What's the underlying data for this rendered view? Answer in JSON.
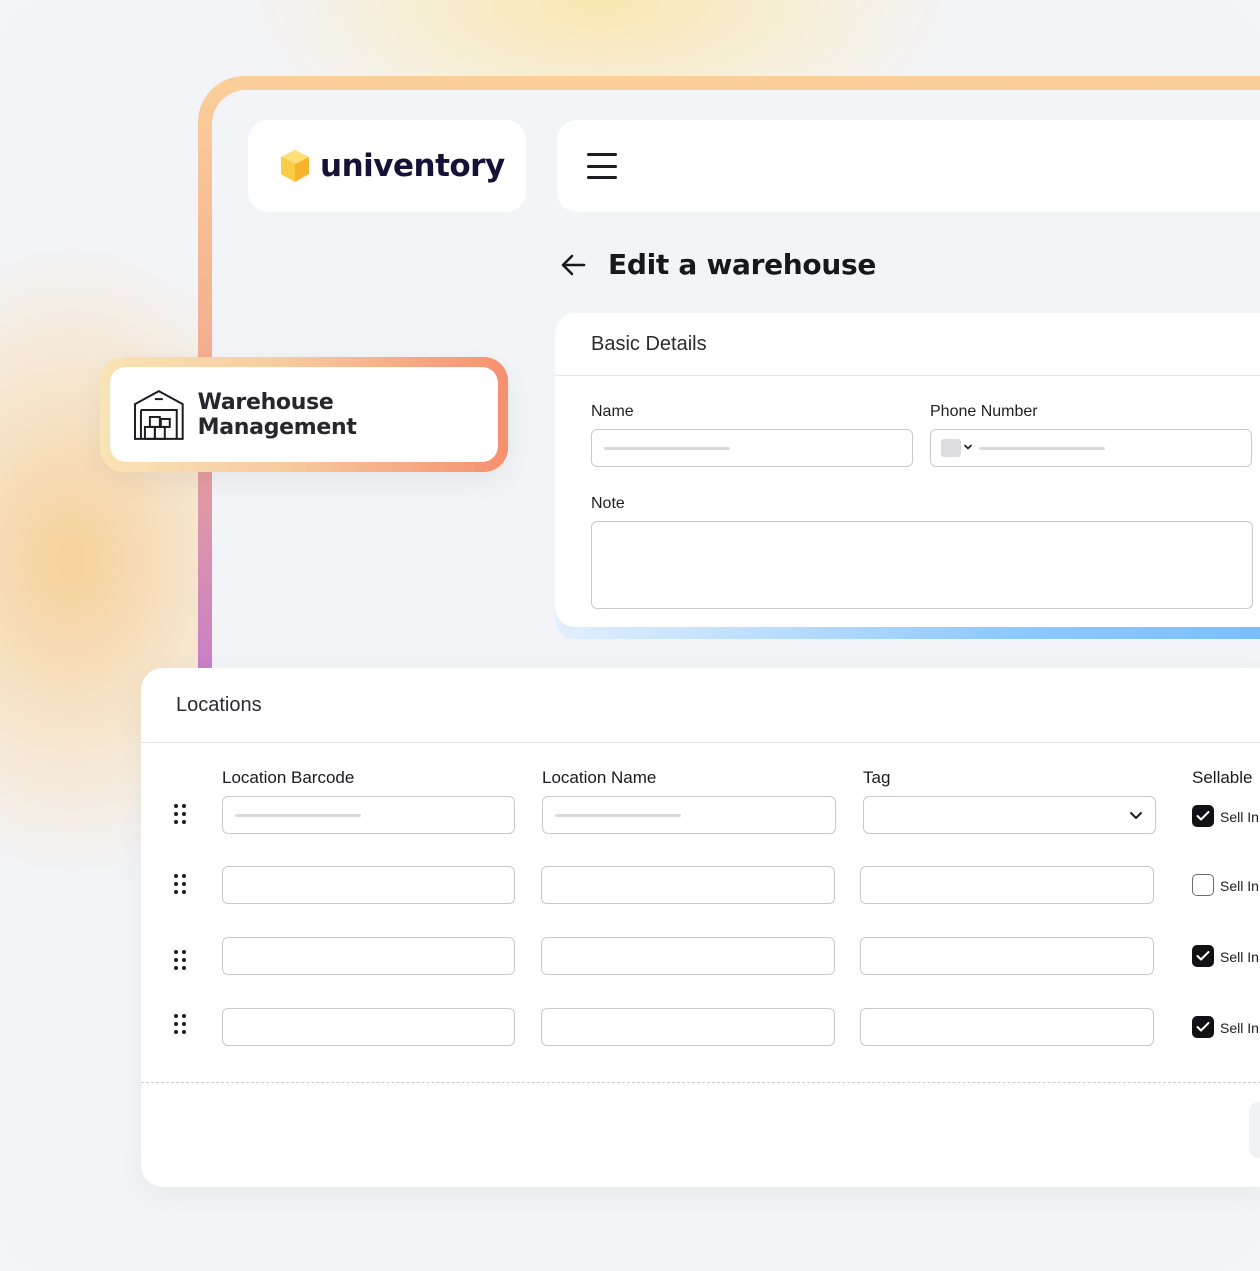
{
  "brand": {
    "name": "univentory"
  },
  "header": {
    "menu_icon": "hamburger-icon"
  },
  "page": {
    "title": "Edit a warehouse",
    "back_icon": "arrow-left-icon"
  },
  "badge": {
    "label": "Warehouse Management",
    "icon": "warehouse-icon"
  },
  "basic_details": {
    "title": "Basic Details",
    "name_label": "Name",
    "phone_label": "Phone Number",
    "note_label": "Note"
  },
  "locations": {
    "title": "Locations",
    "columns": [
      "Location Barcode",
      "Location Name",
      "Tag",
      "Sellable"
    ],
    "rows": [
      {
        "sellable": true,
        "sell_label": "Sell In"
      },
      {
        "sellable": false,
        "sell_label": "Sell In"
      },
      {
        "sellable": true,
        "sell_label": "Sell In"
      },
      {
        "sellable": true,
        "sell_label": "Sell In"
      }
    ]
  },
  "colors": {
    "brand_cube": "#f9c23c",
    "text_dark": "#141236",
    "accent_blue": "#77bcff",
    "accent_orange": "#f6906f"
  }
}
